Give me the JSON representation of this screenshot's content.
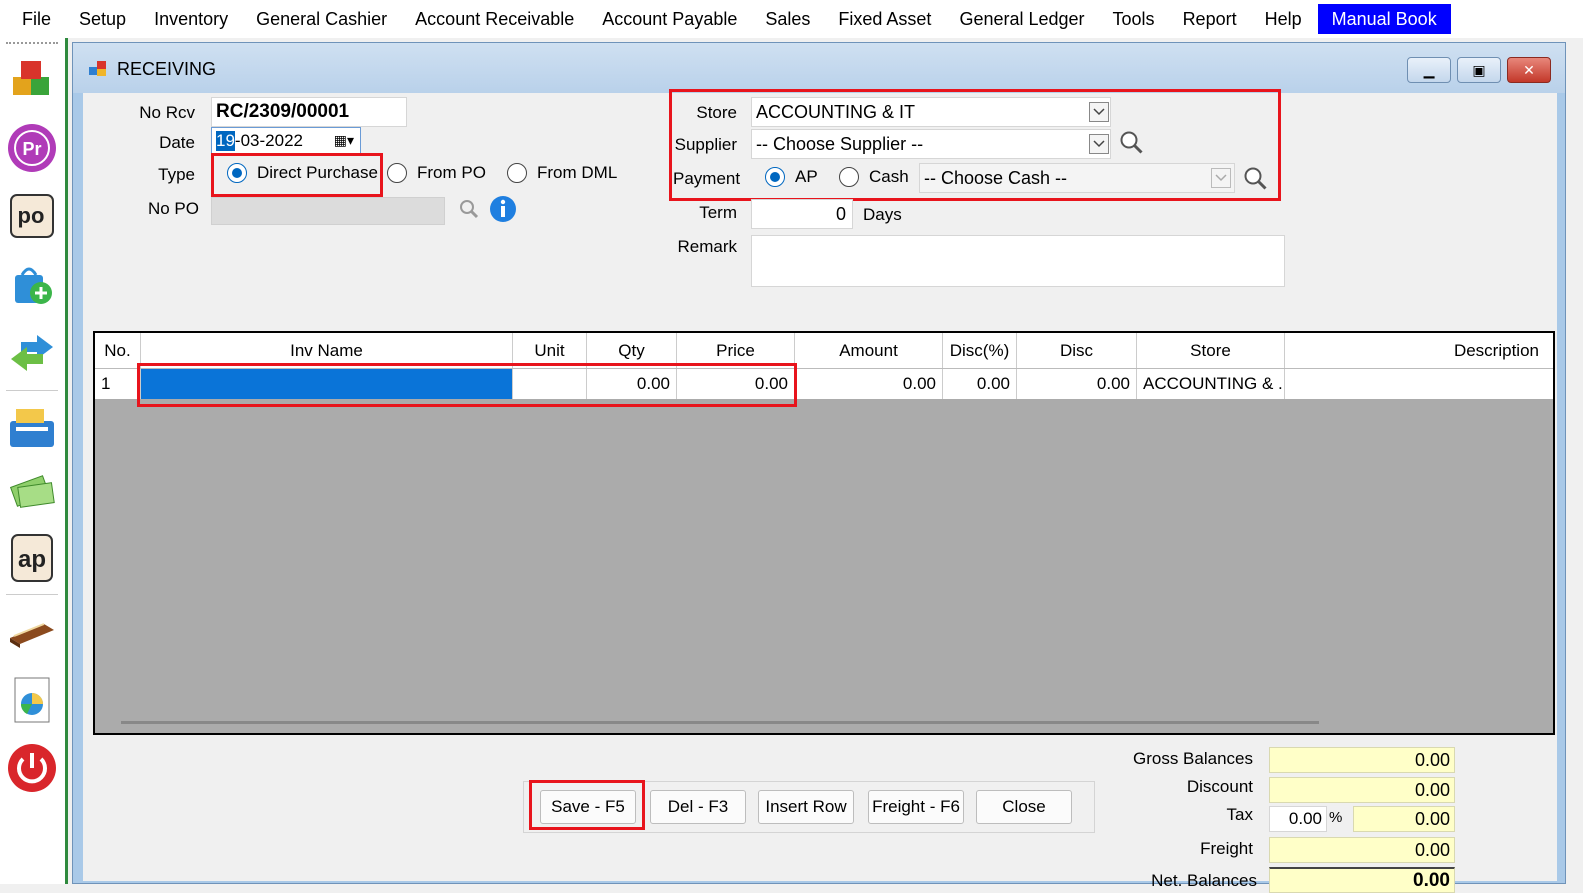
{
  "menu": {
    "items": [
      "File",
      "Setup",
      "Inventory",
      "General Cashier",
      "Account Receivable",
      "Account Payable",
      "Sales",
      "Fixed Asset",
      "General Ledger",
      "Tools",
      "Report",
      "Help"
    ],
    "active": "Manual Book"
  },
  "window": {
    "title": "RECEIVING"
  },
  "form": {
    "no_rcv_label": "No Rcv",
    "no_rcv": "RC/2309/00001",
    "date_label": "Date",
    "date_sel": "19",
    "date_rest": "-03-2022",
    "type_label": "Type",
    "type_options": [
      "Direct Purchase",
      "From PO",
      "From DML"
    ],
    "no_po_label": "No PO",
    "store_label": "Store",
    "store": "ACCOUNTING & IT",
    "supplier_label": "Supplier",
    "supplier": "-- Choose Supplier --",
    "payment_label": "Payment",
    "payment_options": [
      "AP",
      "Cash"
    ],
    "cash": "-- Choose Cash --",
    "term_label": "Term",
    "term": "0",
    "term_unit": "Days",
    "remark_label": "Remark"
  },
  "grid": {
    "headers": [
      "No.",
      "Inv Name",
      "Unit",
      "Qty",
      "Price",
      "Amount",
      "Disc(%)",
      "Disc",
      "Store",
      "Description"
    ],
    "rows": [
      [
        "1",
        "",
        "",
        "0.00",
        "0.00",
        "0.00",
        "0.00",
        "0.00",
        "ACCOUNTING & ...",
        ""
      ]
    ]
  },
  "buttons": [
    "Save - F5",
    "Del - F3",
    "Insert Row",
    "Freight - F6",
    "Close"
  ],
  "totals": {
    "gross_label": "Gross Balances",
    "gross": "0.00",
    "discount_label": "Discount",
    "discount": "0.00",
    "tax_label": "Tax",
    "tax_pct": "0.00",
    "pct_sign": "%",
    "tax": "0.00",
    "freight_label": "Freight",
    "freight": "0.00",
    "net_label": "Net. Balances",
    "net": "0.00"
  },
  "colors": {
    "highlight": "#e8141c",
    "accent": "#0067c0",
    "menu_active": "#0000ff",
    "totals_bg": "#ffffc8"
  }
}
